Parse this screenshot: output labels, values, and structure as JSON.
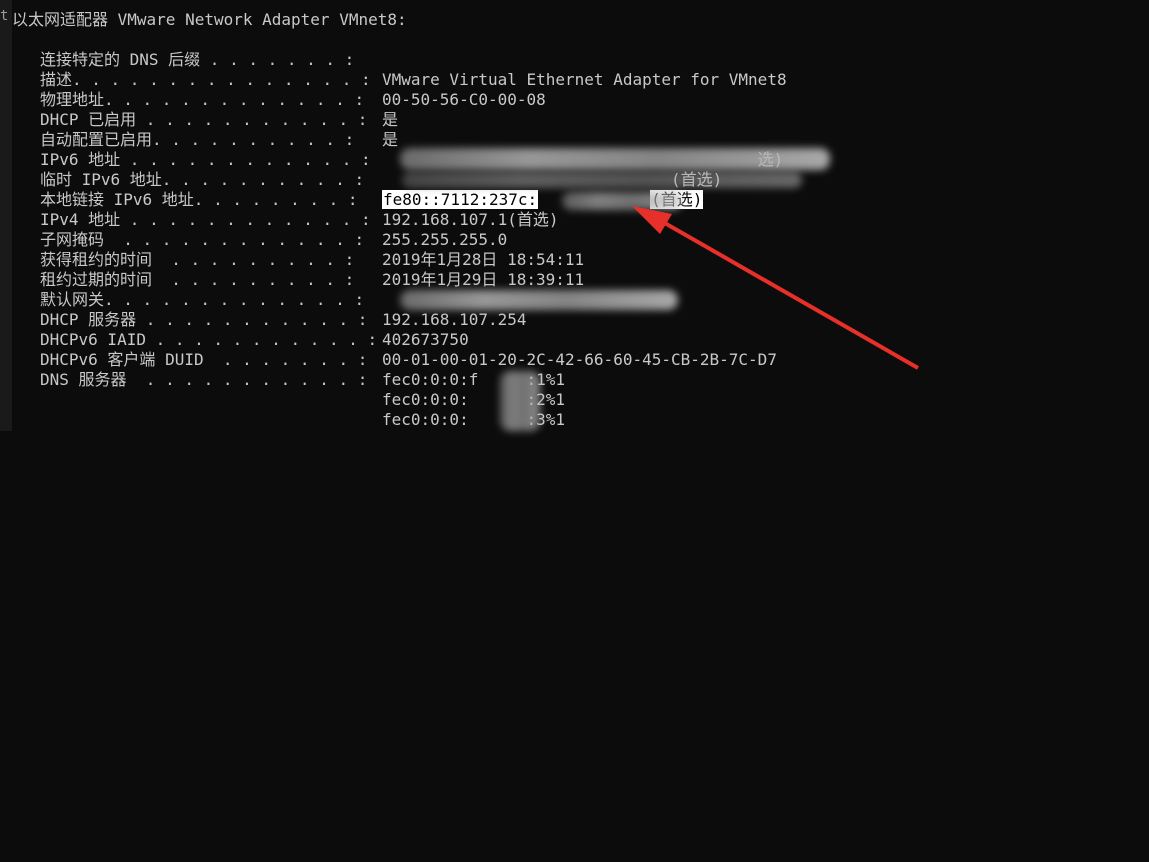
{
  "left_strip": [
    "t",
    "",
    "",
    "",
    "",
    "",
    "",
    "",
    "",
    "",
    "",
    "",
    "",
    "",
    "",
    "",
    "",
    "",
    "",
    "",
    "",
    ""
  ],
  "header": "以太网适配器 VMware Network Adapter VMnet8:",
  "rows": [
    {
      "label": "连接特定的 DNS 后缀 . . . . . . . :",
      "value": ""
    },
    {
      "label": "描述. . . . . . . . . . . . . . . :",
      "value": "VMware Virtual Ethernet Adapter for VMnet8"
    },
    {
      "label": "物理地址. . . . . . . . . . . . . :",
      "value": "00-50-56-C0-00-08"
    },
    {
      "label": "DHCP 已启用 . . . . . . . . . . . :",
      "value": "是"
    },
    {
      "label": "自动配置已启用. . . . . . . . . . :",
      "value": "是"
    },
    {
      "label": "IPv6 地址 . . . . . . . . . . . . :",
      "value": "                                       选)"
    },
    {
      "label": "临时 IPv6 地址. . . . . . . . . . :",
      "value": "                              (首选)"
    },
    {
      "label": "本地链接 IPv6 地址. . . . . . . . :",
      "value_highlight": "fe80::7112:237c:",
      "value_suffix": "(首选)"
    },
    {
      "label": "IPv4 地址 . . . . . . . . . . . . :",
      "value": "192.168.107.1(首选)"
    },
    {
      "label": "子网掩码  . . . . . . . . . . . . :",
      "value": "255.255.255.0"
    },
    {
      "label": "获得租约的时间  . . . . . . . . . :",
      "value": "2019年1月28日 18:54:11"
    },
    {
      "label": "租约过期的时间  . . . . . . . . . :",
      "value": "2019年1月29日 18:39:11"
    },
    {
      "label": "默认网关. . . . . . . . . . . . . :",
      "value": ""
    },
    {
      "label": "DHCP 服务器 . . . . . . . . . . . :",
      "value": "192.168.107.254"
    },
    {
      "label": "DHCPv6 IAID . . . . . . . . . . . :",
      "value": "402673750"
    },
    {
      "label": "DHCPv6 客户端 DUID  . . . . . . . :",
      "value": "00-01-00-01-20-2C-42-66-60-45-CB-2B-7C-D7"
    },
    {
      "label": "DNS 服务器  . . . . . . . . . . . :",
      "value": "fec0:0:0:f     :1%1"
    },
    {
      "label": "",
      "value": "fec0:0:0:      :2%1"
    },
    {
      "label": "",
      "value": "fec0:0:0:      :3%1"
    }
  ],
  "colors": {
    "background": "#0c0c0c",
    "text": "#c8c8c8",
    "arrow": "#e8302a"
  }
}
